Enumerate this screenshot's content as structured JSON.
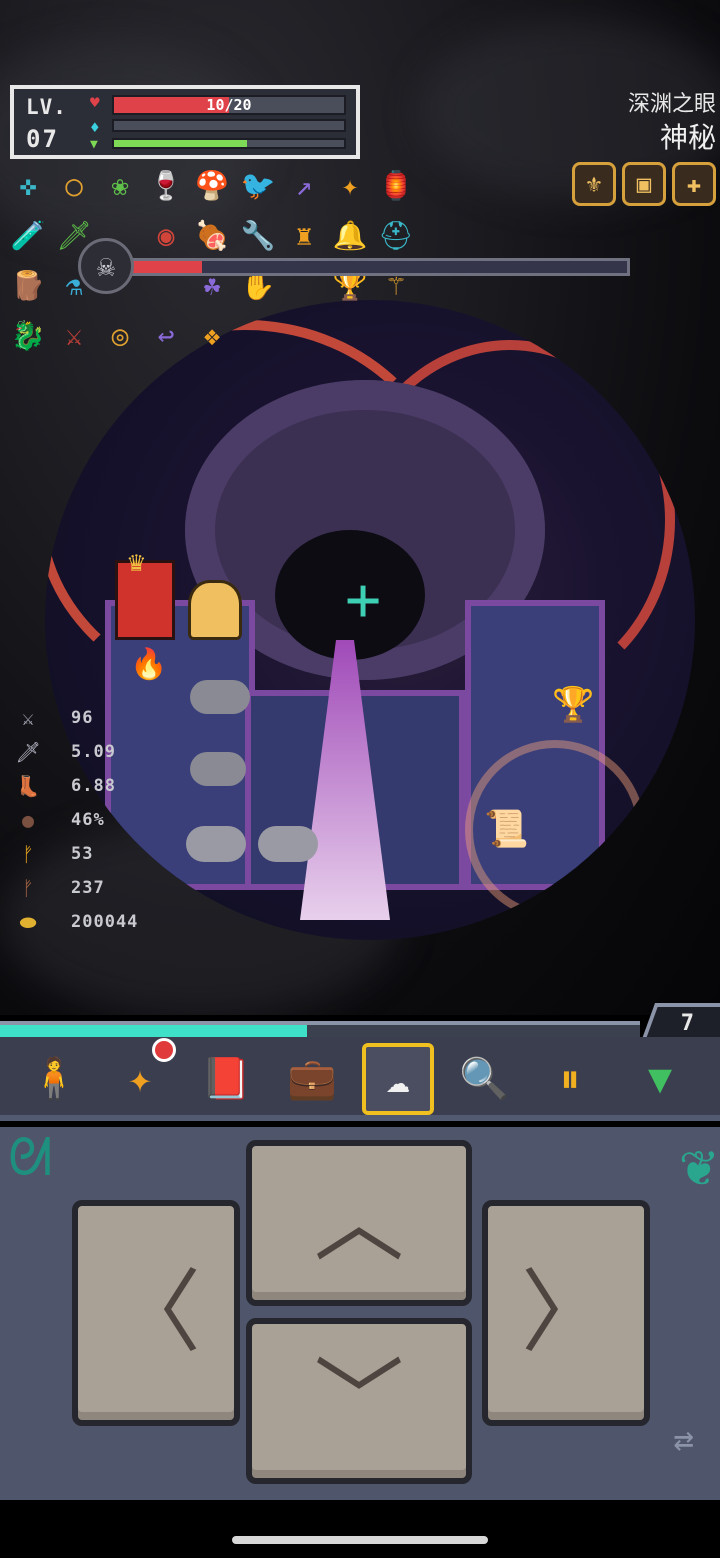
{
  "hud": {
    "level_label": "LV.",
    "level": "07",
    "hp_text": "10/20",
    "hp_fraction": 0.5,
    "mp_fraction": 0.0,
    "xp_fraction": 0.58,
    "colors": {
      "hp": "#e0424a",
      "mp": "#3ad0e0",
      "xp": "#7ed957"
    }
  },
  "area": {
    "name": "深渊之眼",
    "description": "神秘"
  },
  "top_relics": [
    "lantern-relic-icon",
    "shield-relic-icon",
    "cross-relic-icon"
  ],
  "items": [
    "rune-icon",
    "ring-icon",
    "leaf-icon",
    "cup-icon",
    "mushroom-icon",
    "bird-icon",
    "spear-icon",
    "star-icon",
    "lantern-icon",
    "",
    "bottle-icon",
    "sword-icon",
    "",
    "eye-icon",
    "meat-icon",
    "wrench-icon",
    "crown-icon",
    "bell-icon",
    "helmet-icon",
    "",
    "log-icon",
    "potion-icon",
    "",
    "",
    "clover-icon",
    "claw-icon",
    "",
    "chalice-icon",
    "staff-icon",
    "",
    "dragon-icon",
    "blade-icon",
    "target-icon",
    "boomerang-icon",
    "gem-icon",
    "",
    "",
    "",
    "",
    ""
  ],
  "boss": {
    "health_fraction": 0.14,
    "icon": "skull-icon"
  },
  "stats": [
    {
      "icon": "attack-icon",
      "value": "96"
    },
    {
      "icon": "attack-speed-icon",
      "value": "5.09"
    },
    {
      "icon": "move-speed-icon",
      "value": "6.88"
    },
    {
      "icon": "crit-icon",
      "value": "46%"
    },
    {
      "icon": "key-icon",
      "value": "53"
    },
    {
      "icon": "dark-key-icon",
      "value": "237"
    },
    {
      "icon": "gold-icon",
      "value": "200044"
    }
  ],
  "floor_progress_fraction": 0.48,
  "floor": "7",
  "toolbar": [
    {
      "name": "character",
      "icon": "character-icon",
      "glyph": "🧍",
      "selected": false
    },
    {
      "name": "skills",
      "icon": "sparkle-icon",
      "glyph": "✦",
      "selected": false
    },
    {
      "name": "journal",
      "icon": "book-icon",
      "glyph": "📕",
      "selected": false
    },
    {
      "name": "bag",
      "icon": "bag-icon",
      "glyph": "💼",
      "selected": false
    },
    {
      "name": "target",
      "icon": "cloud-target-icon",
      "glyph": "☁",
      "selected": true
    },
    {
      "name": "search",
      "icon": "magnifier-icon",
      "glyph": "🔍",
      "selected": false
    },
    {
      "name": "pause",
      "icon": "pause-icon",
      "glyph": "⏸",
      "selected": false
    },
    {
      "name": "collapse",
      "icon": "collapse-icon",
      "glyph": "▼",
      "selected": false
    }
  ],
  "dpad": {
    "up": "︿",
    "down": "﹀",
    "left": "〈",
    "right": "〉"
  }
}
